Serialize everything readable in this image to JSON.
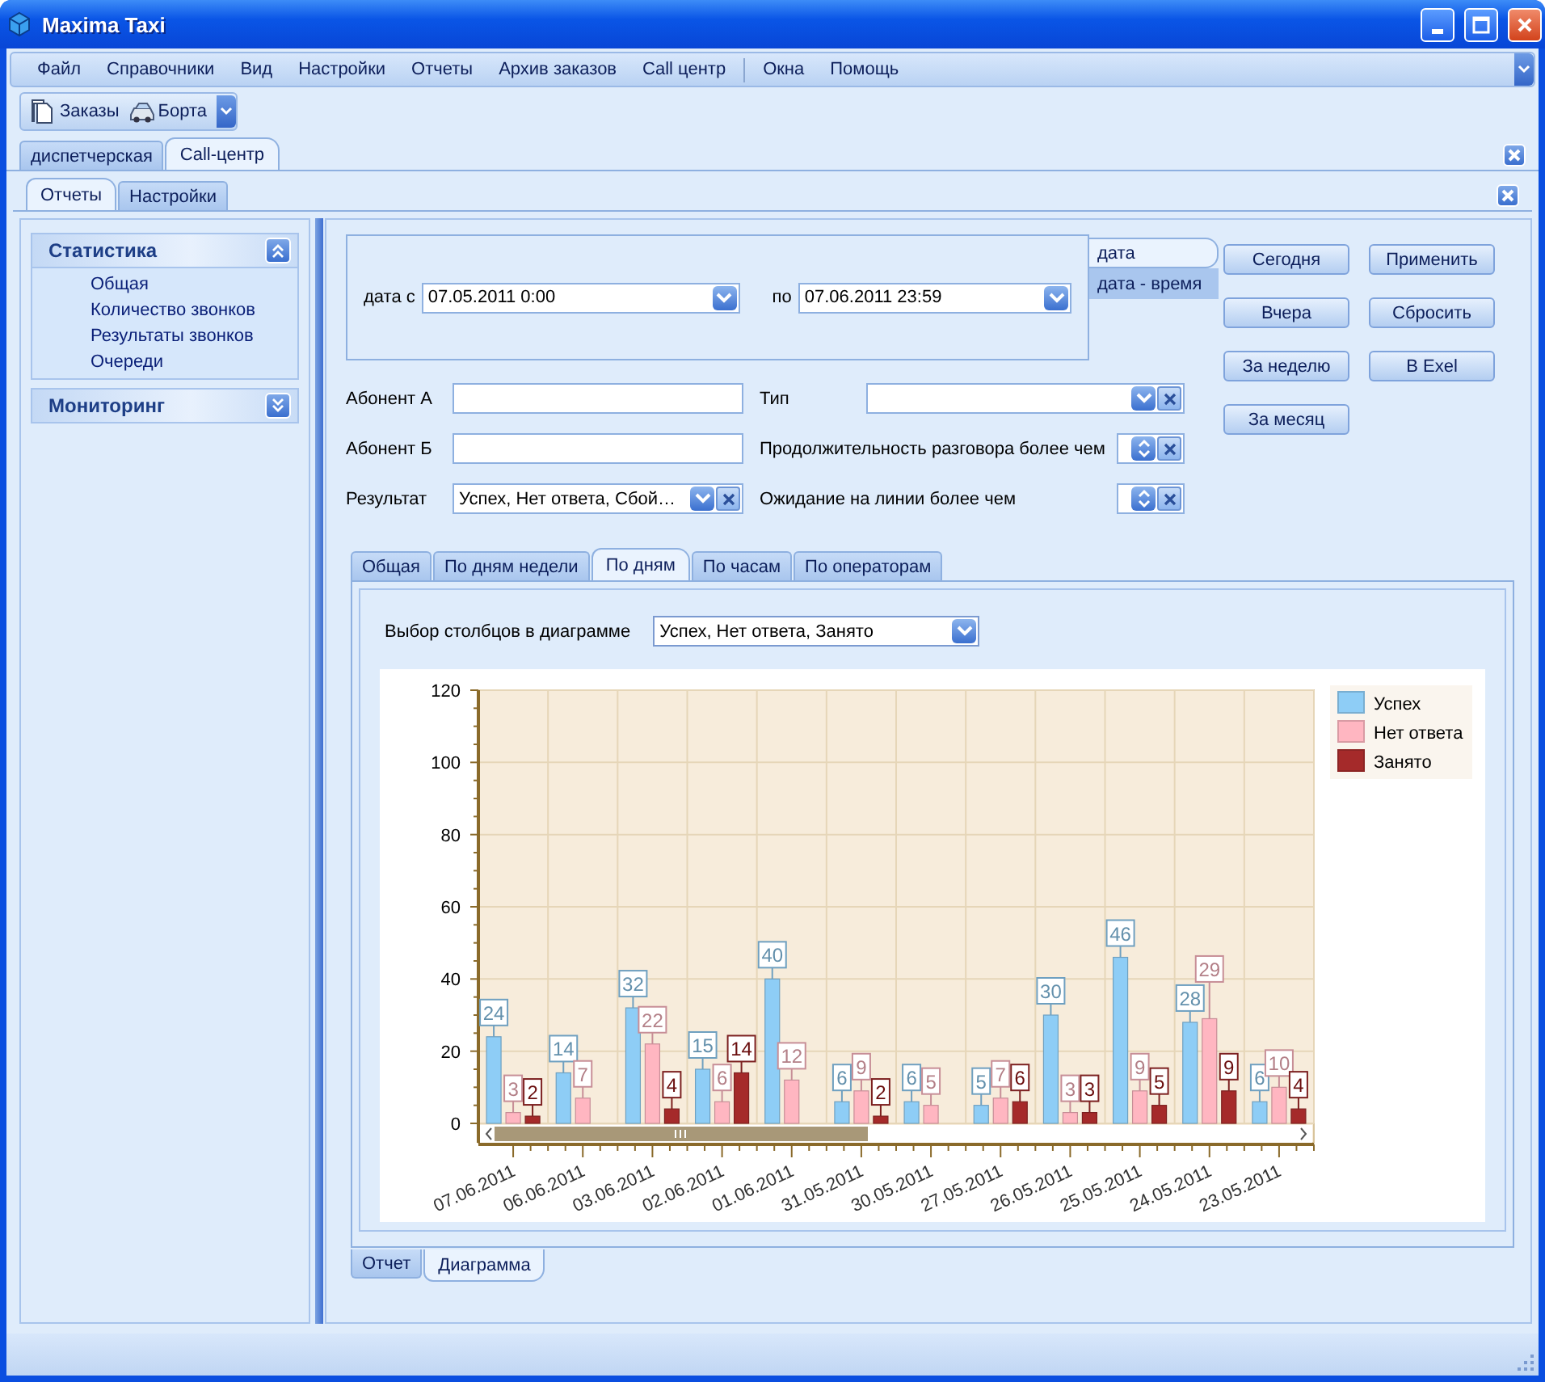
{
  "window": {
    "title": "Maxima Taxi"
  },
  "menu_groups": [
    [
      "Файл",
      "Справочники",
      "Вид",
      "Настройки",
      "Отчеты",
      "Архив заказов",
      "Call центр"
    ],
    [
      "Окна",
      "Помощь"
    ]
  ],
  "toolbar": [
    {
      "label": "Заказы",
      "kind": "document"
    },
    {
      "label": "Борта",
      "kind": "car"
    }
  ],
  "document_tabs": [
    {
      "label": "диспетчерская",
      "selected": false
    },
    {
      "label": "Call-центр",
      "selected": true
    }
  ],
  "section_tabs": [
    {
      "label": "Отчеты",
      "selected": true
    },
    {
      "label": "Настройки",
      "selected": false
    }
  ],
  "sidebar": {
    "groups": [
      {
        "title": "Статистика",
        "expanded": true,
        "items": [
          "Общая",
          "Количество звонков",
          "Результаты звонков",
          "Очереди"
        ]
      },
      {
        "title": "Мониторинг",
        "expanded": false
      }
    ]
  },
  "date_range": {
    "from_label": "дата с",
    "from": "07.05.2011 0:00",
    "to_label": "по",
    "to": "07.06.2011 23:59",
    "modes": [
      {
        "label": "дата",
        "selected": true
      },
      {
        "label": "дата - время",
        "selected": false
      }
    ]
  },
  "quick_buttons": [
    [
      "Сегодня",
      "Вчера",
      "За неделю",
      "За месяц"
    ],
    [
      "Применить",
      "Сбросить",
      "В Exel"
    ]
  ],
  "filters": [
    {
      "label": "Абонент А",
      "kind": "text"
    },
    {
      "label": "Тип",
      "kind": "combo"
    },
    {
      "label": "Абонент Б",
      "kind": "text"
    },
    {
      "label": "Продолжительность разговора более чем",
      "kind": "spin"
    },
    {
      "label": "Результат",
      "kind": "combo",
      "value": "Успех, Нет ответа, Сбой…"
    },
    {
      "label": "Ожидание на линии более чем",
      "kind": "spin"
    }
  ],
  "report_tabs": [
    {
      "label": "Общая",
      "selected": false
    },
    {
      "label": "По дням недели",
      "selected": false
    },
    {
      "label": "По дням",
      "selected": true
    },
    {
      "label": "По часам",
      "selected": false
    },
    {
      "label": "По операторам",
      "selected": false
    }
  ],
  "column_picker": {
    "label": "Выбор столбцов в диаграмме",
    "value": "Успех, Нет ответа, Занято"
  },
  "chart_data": {
    "type": "bar",
    "categories": [
      "07.06.2011",
      "06.06.2011",
      "03.06.2011",
      "02.06.2011",
      "01.06.2011",
      "31.05.2011",
      "30.05.2011",
      "27.05.2011",
      "26.05.2011",
      "25.05.2011",
      "24.05.2011",
      "23.05.2011"
    ],
    "series": [
      {
        "name": "Успех",
        "color": "#8ecdf6",
        "values": [
          24,
          14,
          32,
          15,
          40,
          6,
          6,
          5,
          30,
          46,
          28,
          6
        ]
      },
      {
        "name": "Нет ответа",
        "color": "#ffb6c1",
        "values": [
          3,
          7,
          22,
          6,
          12,
          9,
          5,
          7,
          3,
          9,
          29,
          10
        ]
      },
      {
        "name": "Занято",
        "color": "#a52a2a",
        "values": [
          2,
          null,
          4,
          14,
          null,
          2,
          null,
          6,
          3,
          5,
          9,
          4
        ]
      }
    ],
    "ylim": [
      0,
      120
    ],
    "yticks": [
      0,
      20,
      40,
      60,
      80,
      100,
      120
    ],
    "data_labels": true,
    "grid": true,
    "legend": true
  },
  "view_tabs": [
    {
      "label": "Отчет",
      "selected": false
    },
    {
      "label": "Диаграмма",
      "selected": true
    }
  ]
}
